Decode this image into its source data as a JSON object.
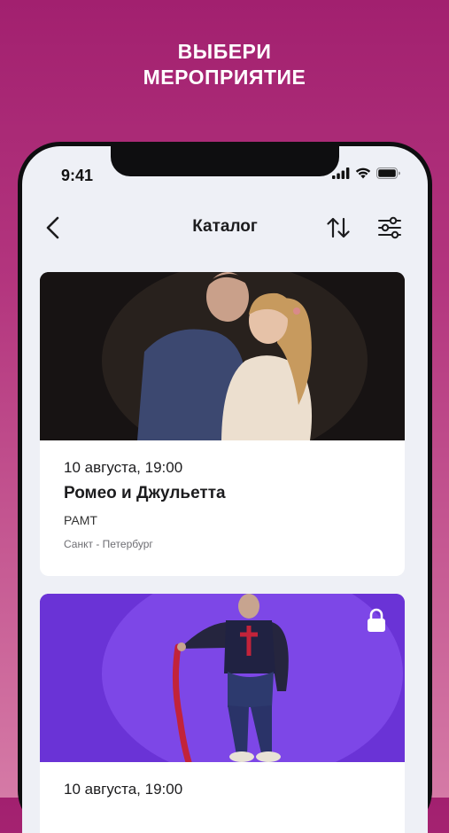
{
  "promo": {
    "line1": "ВЫБЕРИ",
    "line2": "МЕРОПРИЯТИЕ"
  },
  "status_bar": {
    "time": "9:41",
    "icons": [
      "signal-icon",
      "wifi-icon",
      "battery-icon"
    ]
  },
  "header": {
    "title": "Каталог",
    "back_icon": "chevron-left-icon",
    "sort_icon": "sort-arrows-icon",
    "filter_icon": "filter-sliders-icon"
  },
  "events": [
    {
      "date": "10 августа, 19:00",
      "title": "Ромео и Джульетта",
      "venue": "РАМТ",
      "city": "Санкт - Петербург",
      "image": "romeo-juliet-photo",
      "locked": false
    },
    {
      "date": "10 августа, 19:00",
      "image": "hamlet-stage-photo",
      "locked": true
    }
  ],
  "colors": {
    "background_top": "#a2206f",
    "background_bottom": "#d57aa6",
    "screen_bg": "#eef0f6",
    "card_bg": "#ffffff",
    "text_primary": "#1c1c1e"
  }
}
